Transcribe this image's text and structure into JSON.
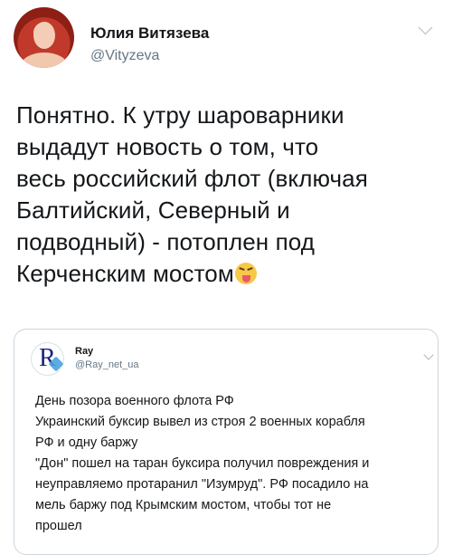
{
  "tweet": {
    "author_name": "Юлия Витязева",
    "author_handle": "@Vityzeva",
    "text_lines": [
      "Понятно. К утру шароварники",
      "выдадут новость о том, что",
      "весь российский флот (включая",
      "Балтийский, Северный и",
      "подводный) - потоплен под",
      "Керченским мостом"
    ],
    "emoji": "squinting-tongue-face"
  },
  "quoted_tweet": {
    "author_name": "Ray",
    "author_handle": "@Ray_net_ua",
    "avatar_letter": "R",
    "text_lines": [
      "День позора военного флота РФ",
      "Украинский буксир вывел из строя 2 военных корабля",
      "РФ и одну баржу",
      "\"Дон\" пошел на таран буксира получил повреждения и",
      "неуправляемо протаранил \"Изумруд\". РФ посадило на",
      "мель баржу под Крымским мостом, чтобы тот не",
      "прошел"
    ]
  },
  "colors": {
    "text_primary": "#14171a",
    "text_secondary": "#657786",
    "border": "#ccd6dd"
  }
}
